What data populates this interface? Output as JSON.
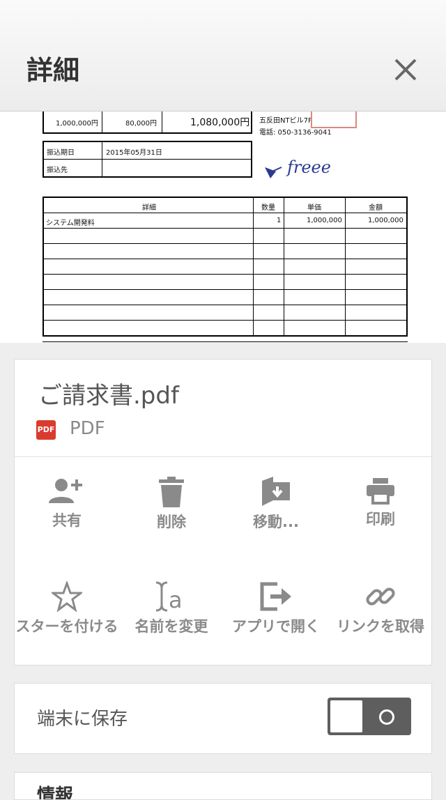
{
  "header": {
    "title": "詳細",
    "close_icon": "close-icon"
  },
  "preview": {
    "amount_row": [
      "1,000,000円",
      "80,000円",
      "1,080,000円"
    ],
    "payment": {
      "due_label": "振込期日",
      "due_value": "2015年05月31日",
      "dest_label": "振込先",
      "dest_value": ""
    },
    "company": {
      "address": "五反田NTビル7F",
      "phone": "電話: 050-3136-9041"
    },
    "logo_text": "freee",
    "table": {
      "headers": [
        "詳細",
        "数量",
        "単価",
        "金額"
      ],
      "rows": [
        [
          "システム開発料",
          "1",
          "1,000,000",
          "1,000,000"
        ]
      ]
    }
  },
  "file": {
    "name": "ご請求書.pdf",
    "type": "PDF",
    "badge": "PDF"
  },
  "actions": [
    {
      "label": "共有",
      "icon": "add-person-icon"
    },
    {
      "label": "削除",
      "icon": "trash-icon"
    },
    {
      "label": "移動...",
      "icon": "move-folder-icon"
    },
    {
      "label": "印刷",
      "icon": "printer-icon"
    },
    {
      "label": "スターを付ける",
      "icon": "star-icon"
    },
    {
      "label": "名前を変更",
      "icon": "rename-icon"
    },
    {
      "label": "アプリで開く",
      "icon": "open-with-icon"
    },
    {
      "label": "リンクを取得",
      "icon": "link-icon"
    }
  ],
  "offline": {
    "label": "端末に保存",
    "enabled": false
  },
  "info": {
    "heading": "情報"
  }
}
